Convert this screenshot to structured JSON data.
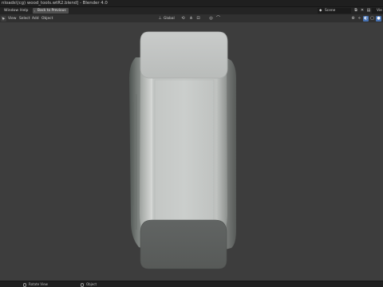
{
  "window": {
    "title": "nloads\\(cg) wood_tools.wtR2.blend] - Blender 4.0"
  },
  "menubar": {
    "items": [
      "Window",
      "Help"
    ],
    "back_to_previous": "Back to Previous",
    "scene": "Scene",
    "view_layer": "Vie"
  },
  "viewport_header": {
    "menus": [
      "View",
      "Select",
      "Add",
      "Object"
    ],
    "transform_orientation": "Global",
    "active_shading": "solid"
  },
  "statusbar": {
    "left_hint": "Rotate View",
    "mid_hint": "Object"
  },
  "colors": {
    "viewport_bg": "#3d3d3d",
    "header_bg": "#303030",
    "accent": "#4772b3",
    "object_light": "#c8c8c8",
    "object_dark": "#5a5a5a"
  }
}
